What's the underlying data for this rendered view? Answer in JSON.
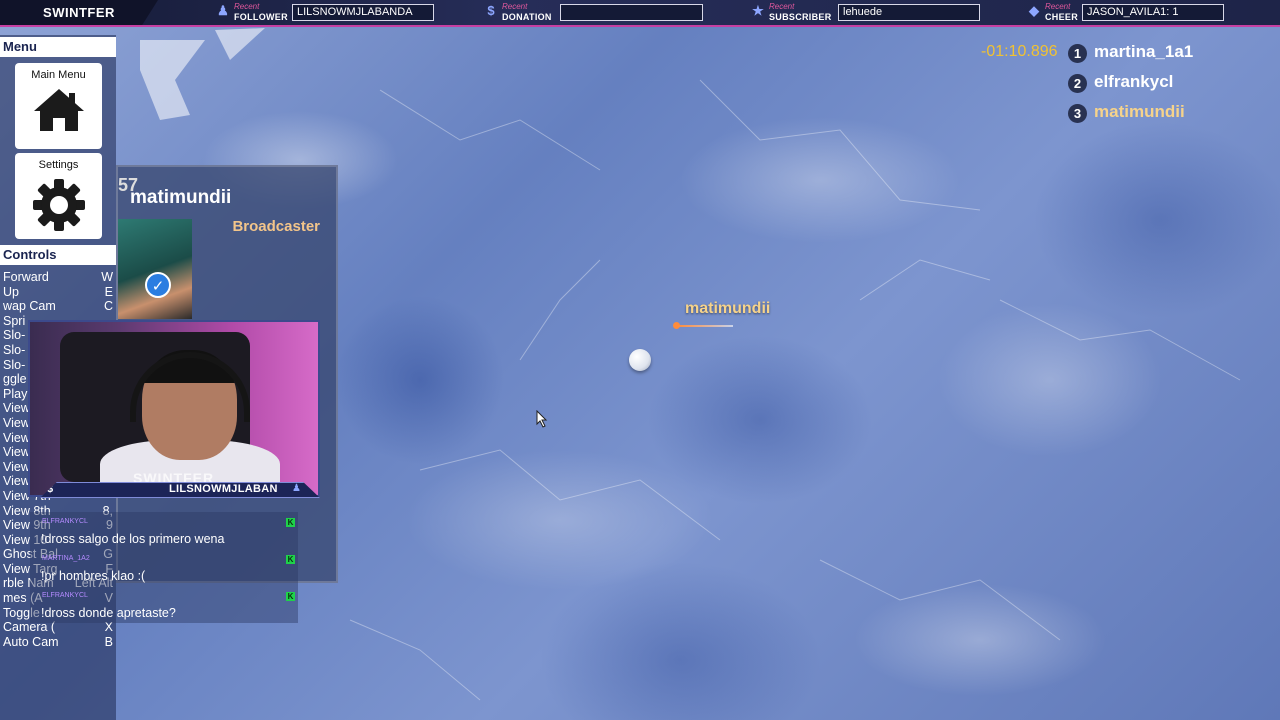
{
  "topbar": {
    "brand": "SWINTFER",
    "recent_label": "Recent",
    "follower": {
      "label": "FOLLOWER",
      "value": "LILSNOWMJLABANDA",
      "icon": "user-icon"
    },
    "donation": {
      "label": "DONATION",
      "value": "",
      "icon": "dollar-icon"
    },
    "subscriber": {
      "label": "SUBSCRIBER",
      "value": "lehuede",
      "icon": "star-icon"
    },
    "cheer": {
      "label": "CHEER",
      "value": "JASON_AVILA1: 1",
      "icon": "diamond-icon"
    }
  },
  "menu": {
    "title": "Menu",
    "main_menu": "Main Menu",
    "settings": "Settings"
  },
  "controls": {
    "title": "Controls",
    "items": [
      {
        "action": "Forward",
        "key": "W"
      },
      {
        "action": "Up",
        "key": "E"
      },
      {
        "action": "wap Cam",
        "key": "C"
      },
      {
        "action": "Spri",
        "key": ""
      },
      {
        "action": "Slo-",
        "key": ""
      },
      {
        "action": "Slo-",
        "key": ""
      },
      {
        "action": "Slo-",
        "key": ""
      },
      {
        "action": "ggle",
        "key": ""
      },
      {
        "action": "Play",
        "key": ""
      },
      {
        "action": "View",
        "key": ""
      },
      {
        "action": "View",
        "key": ""
      },
      {
        "action": "View",
        "key": ""
      },
      {
        "action": "View",
        "key": ""
      },
      {
        "action": "View",
        "key": ""
      },
      {
        "action": "View",
        "key": ""
      },
      {
        "action": "View 7th",
        "key": ""
      },
      {
        "action": "View 8th",
        "key": "8,"
      },
      {
        "action": "View 9th",
        "key": "9"
      },
      {
        "action": "View 10",
        "key": ""
      },
      {
        "action": "Ghost Bal",
        "key": "G"
      },
      {
        "action": "View Targ",
        "key": "F"
      },
      {
        "action": "rble Nam",
        "key": "Left Alt"
      },
      {
        "action": "mes (A",
        "key": "V"
      },
      {
        "action": "Toggle",
        "key": ""
      },
      {
        "action": "Camera (",
        "key": "X"
      },
      {
        "action": "Auto Cam",
        "key": "B"
      }
    ]
  },
  "broadcaster_card": {
    "number": "57",
    "name": "matimundii",
    "role": "Broadcaster"
  },
  "webcam": {
    "brand": "SWINTFER",
    "footer_name": "LILSNOWMJLABAN",
    "currency_icon": "$"
  },
  "chat": [
    {
      "user": "ELFRANKYCL",
      "text": "!dross salgo de los primero wena",
      "badge": "K"
    },
    {
      "user": "MARTINA_1A2",
      "text": "!pr hombres klao :(",
      "badge": "K"
    },
    {
      "user": "ELFRANKYCL",
      "text": "!dross donde apretaste?",
      "badge": "K"
    }
  ],
  "race": {
    "timer": "-01:10.896",
    "leaderboard": [
      {
        "rank": "1",
        "name": "martina_1a1",
        "color": "#ffffff"
      },
      {
        "rank": "2",
        "name": "elfrankycl",
        "color": "#ffffff"
      },
      {
        "rank": "3",
        "name": "matimundii",
        "color": "#f6d38b"
      }
    ]
  },
  "marble": {
    "label": "matimundii"
  },
  "colors": {
    "accent_pink": "#c63fa2",
    "timer": "#f1c232",
    "highlight_name": "#f6d38b"
  }
}
